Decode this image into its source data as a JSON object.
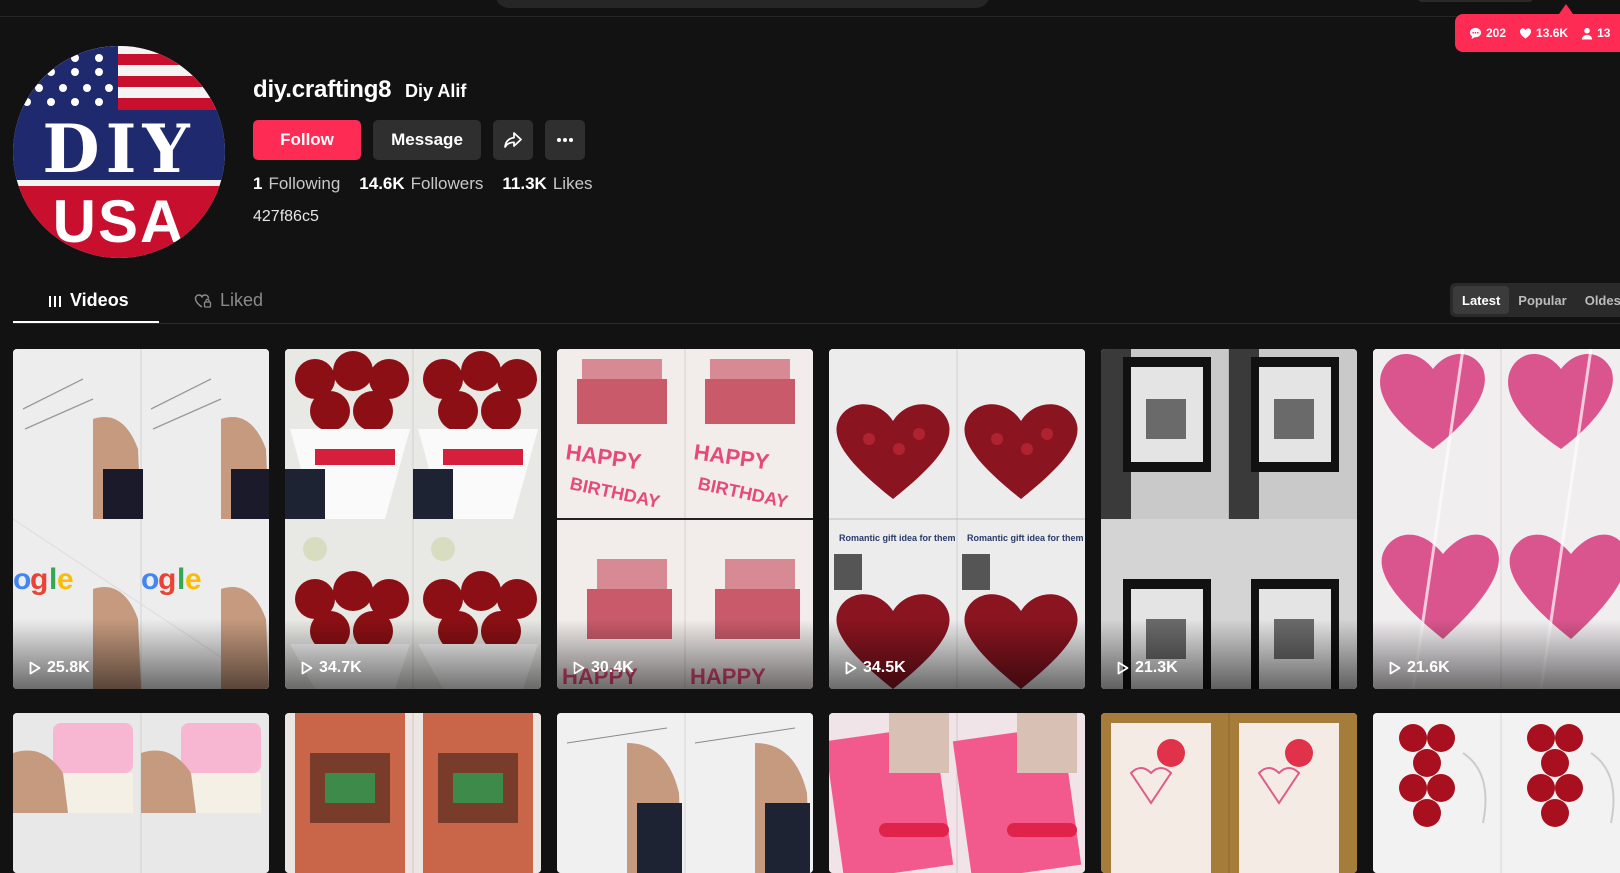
{
  "live_stats": {
    "comments": "202",
    "likes": "13.6K",
    "viewers": "13"
  },
  "profile": {
    "avatar_top": "DIY",
    "avatar_bottom": "USA",
    "username": "diy.crafting8",
    "nickname": "Diy Alif",
    "follow_label": "Follow",
    "message_label": "Message",
    "following_count": "1",
    "following_label": "Following",
    "followers_count": "14.6K",
    "followers_label": "Followers",
    "likes_count": "11.3K",
    "likes_label": "Likes",
    "bio": "427f86c5"
  },
  "tabs": [
    {
      "label": "Videos"
    },
    {
      "label": "Liked"
    }
  ],
  "sort": [
    {
      "label": "Latest"
    },
    {
      "label": "Popular"
    },
    {
      "label": "Oldest"
    }
  ],
  "videos": [
    {
      "views": "25.8K",
      "theme": "note"
    },
    {
      "views": "34.7K",
      "theme": "roses"
    },
    {
      "views": "30.4K",
      "theme": "birthday"
    },
    {
      "views": "34.5K",
      "theme": "heart"
    },
    {
      "views": "21.3K",
      "theme": "frame"
    },
    {
      "views": "21.6K",
      "theme": "kisses"
    },
    {
      "views": "",
      "theme": "card"
    },
    {
      "views": "",
      "theme": "bookshop"
    },
    {
      "views": "",
      "theme": "letter"
    },
    {
      "views": "",
      "theme": "pink"
    },
    {
      "views": "",
      "theme": "envelope"
    },
    {
      "views": "",
      "theme": "roseheart"
    }
  ],
  "colors": {
    "accent": "#fe2c55",
    "background": "#121212",
    "button_dark": "#2f2f2f"
  }
}
